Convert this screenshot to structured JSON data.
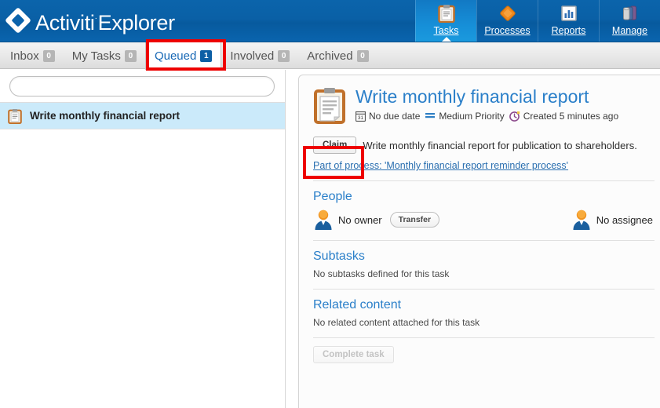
{
  "header": {
    "logo_primary": "Activiti",
    "logo_tm": "·",
    "logo_secondary": "Explorer",
    "logo_icon": "diamond-logo-icon",
    "nav": [
      {
        "label": "Tasks",
        "icon": "clipboard-icon",
        "active": true
      },
      {
        "label": "Processes",
        "icon": "orange-diamond-icon",
        "active": false
      },
      {
        "label": "Reports",
        "icon": "bar-chart-icon",
        "active": false
      },
      {
        "label": "Manage",
        "icon": "database-icon",
        "active": false
      }
    ]
  },
  "subtabs": [
    {
      "label": "Inbox",
      "count": "0",
      "active": false
    },
    {
      "label": "My Tasks",
      "count": "0",
      "active": false
    },
    {
      "label": "Queued",
      "count": "1",
      "active": true
    },
    {
      "label": "Involved",
      "count": "0",
      "active": false
    },
    {
      "label": "Archived",
      "count": "0",
      "active": false
    }
  ],
  "search": {
    "value": "",
    "placeholder": ""
  },
  "task_list": [
    {
      "title": "Write monthly financial report",
      "icon": "clipboard-icon",
      "selected": true
    }
  ],
  "detail": {
    "icon": "clipboard-large-icon",
    "title": "Write monthly financial report",
    "meta": {
      "due_date": "No due date",
      "due_date_icon": "calendar-icon",
      "priority": "Medium Priority",
      "priority_icon": "priority-bars-icon",
      "created": "Created 5 minutes ago",
      "created_icon": "clock-icon"
    },
    "claim_button": "Claim",
    "description": "Write monthly financial report for publication to shareholders.",
    "process_link": "Part of process: 'Monthly financial report reminder process'",
    "people": {
      "title": "People",
      "owner_label": "No owner",
      "owner_icon": "avatar-icon",
      "transfer_button": "Transfer",
      "assignee_label": "No assignee",
      "assignee_icon": "avatar-icon"
    },
    "subtasks": {
      "title": "Subtasks",
      "empty": "No subtasks defined for this task"
    },
    "related_content": {
      "title": "Related content",
      "empty": "No related content attached for this task"
    },
    "complete_button": "Complete task"
  },
  "annotations": [
    {
      "name": "queued-tab-highlight",
      "color": "#ee0000"
    },
    {
      "name": "claim-button-highlight",
      "color": "#ee0000"
    }
  ]
}
